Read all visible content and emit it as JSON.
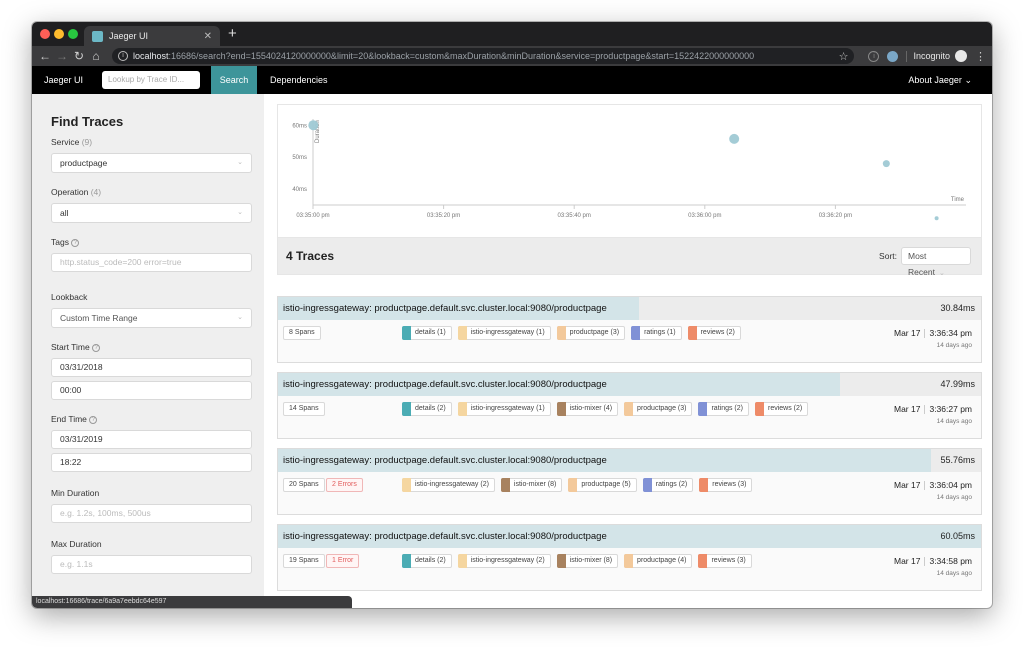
{
  "browser": {
    "tab_title": "Jaeger UI",
    "url_host": "localhost",
    "url_rest": ":16686/search?end=1554024120000000&limit=20&lookback=custom&maxDuration&minDuration&service=productpage&start=1522422000000000",
    "incognito_label": "Incognito",
    "status_url": "localhost:16686/trace/6a9a7eebdc64e597"
  },
  "nav": {
    "brand": "Jaeger UI",
    "lookup_placeholder": "Lookup by Trace ID...",
    "search_label": "Search",
    "dependencies_label": "Dependencies",
    "about_label": "About Jaeger"
  },
  "sidebar": {
    "title": "Find Traces",
    "service_label": "Service",
    "service_count": "(9)",
    "service_value": "productpage",
    "operation_label": "Operation",
    "operation_count": "(4)",
    "operation_value": "all",
    "tags_label": "Tags",
    "tags_placeholder": "http.status_code=200 error=true",
    "lookback_label": "Lookback",
    "lookback_value": "Custom Time Range",
    "start_time_label": "Start Time",
    "start_date": "03/31/2018",
    "start_clock": "00:00",
    "end_time_label": "End Time",
    "end_date": "03/31/2019",
    "end_clock": "18:22",
    "min_duration_label": "Min Duration",
    "min_duration_placeholder": "e.g. 1.2s, 100ms, 500us",
    "max_duration_label": "Max Duration",
    "max_duration_placeholder": "e.g. 1.1s"
  },
  "chart_data": {
    "type": "scatter",
    "ylabel": "Duration",
    "xlabel": "Time",
    "y_ticks": [
      "40ms",
      "50ms",
      "60ms"
    ],
    "x_ticks": [
      "03:35:00 pm",
      "03:35:20 pm",
      "03:35:40 pm",
      "03:36:00 pm",
      "03:36:20 pm"
    ],
    "ylim": [
      35,
      62
    ],
    "xlim": [
      0,
      100
    ],
    "x_tick_values": [
      0,
      20,
      40,
      60,
      80
    ],
    "points": [
      {
        "x": 0.05,
        "y": 60.05,
        "r": 5
      },
      {
        "x": 64.5,
        "y": 55.76,
        "r": 5
      },
      {
        "x": 87.8,
        "y": 47.99,
        "r": 3.5
      },
      {
        "x": 95.5,
        "y": 30.84,
        "r": 2
      }
    ],
    "color": "#9fc9d4"
  },
  "results": {
    "title": "4 Traces",
    "sort_label": "Sort:",
    "sort_value": "Most Recent"
  },
  "traces": [
    {
      "name": "istio-ingressgateway: productpage.default.svc.cluster.local:9080/productpage",
      "duration": "30.84ms",
      "fill": 0.514,
      "spans": "8 Spans",
      "errors": "",
      "services": [
        {
          "label": "details (1)",
          "color": "#4bacb4"
        },
        {
          "label": "istio-ingressgateway (1)",
          "color": "#f5d6a0"
        },
        {
          "label": "productpage (3)",
          "color": "#f3c99b"
        },
        {
          "label": "ratings (1)",
          "color": "#8091d6"
        },
        {
          "label": "reviews (2)",
          "color": "#ee8b68"
        }
      ],
      "date": "Mar 17",
      "time": "3:36:34 pm",
      "ago": "14 days ago"
    },
    {
      "name": "istio-ingressgateway: productpage.default.svc.cluster.local:9080/productpage",
      "duration": "47.99ms",
      "fill": 0.799,
      "spans": "14 Spans",
      "errors": "",
      "services": [
        {
          "label": "details (2)",
          "color": "#4bacb4"
        },
        {
          "label": "istio-ingressgateway (1)",
          "color": "#f5d6a0"
        },
        {
          "label": "istio-mixer (4)",
          "color": "#a8825f"
        },
        {
          "label": "productpage (3)",
          "color": "#f3c99b"
        },
        {
          "label": "ratings (2)",
          "color": "#8091d6"
        },
        {
          "label": "reviews (2)",
          "color": "#ee8b68"
        }
      ],
      "date": "Mar 17",
      "time": "3:36:27 pm",
      "ago": "14 days ago"
    },
    {
      "name": "istio-ingressgateway: productpage.default.svc.cluster.local:9080/productpage",
      "duration": "55.76ms",
      "fill": 0.929,
      "spans": "20 Spans",
      "errors": "2 Errors",
      "services": [
        {
          "label": "istio-ingressgateway (2)",
          "color": "#f5d6a0"
        },
        {
          "label": "istio-mixer (8)",
          "color": "#a8825f"
        },
        {
          "label": "productpage (5)",
          "color": "#f3c99b"
        },
        {
          "label": "ratings (2)",
          "color": "#8091d6"
        },
        {
          "label": "reviews (3)",
          "color": "#ee8b68"
        }
      ],
      "date": "Mar 17",
      "time": "3:36:04 pm",
      "ago": "14 days ago"
    },
    {
      "name": "istio-ingressgateway: productpage.default.svc.cluster.local:9080/productpage",
      "duration": "60.05ms",
      "fill": 1.0,
      "spans": "19 Spans",
      "errors": "1 Error",
      "services": [
        {
          "label": "details (2)",
          "color": "#4bacb4"
        },
        {
          "label": "istio-ingressgateway (2)",
          "color": "#f5d6a0"
        },
        {
          "label": "istio-mixer (8)",
          "color": "#a8825f"
        },
        {
          "label": "productpage (4)",
          "color": "#f3c99b"
        },
        {
          "label": "reviews (3)",
          "color": "#ee8b68"
        }
      ],
      "date": "Mar 17",
      "time": "3:34:58 pm",
      "ago": "14 days ago"
    }
  ]
}
